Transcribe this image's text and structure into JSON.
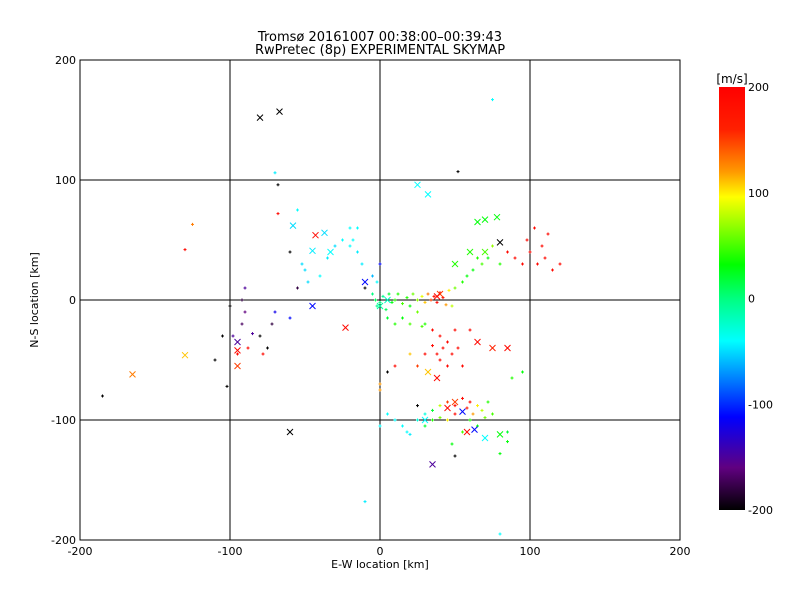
{
  "chart_data": {
    "type": "scatter",
    "title": "Tromsø 20161007 00:38:00–00:39:43",
    "subtitle": "RwPretec (8p) EXPERIMENTAL SKYMAP",
    "xlabel": "E-W location [km]",
    "ylabel": "N-S location [km]",
    "xlim": [
      -200,
      200
    ],
    "ylim": [
      -200,
      200
    ],
    "xticks": [
      "-200",
      "-100",
      "0",
      "100",
      "200"
    ],
    "yticks": [
      "-200",
      "-100",
      "0",
      "100",
      "200"
    ],
    "grid": true,
    "colorbar": {
      "label": "[m/s]",
      "range": [
        -200,
        200
      ],
      "ticks": [
        "200",
        "100",
        "0",
        "-100",
        "-200"
      ]
    },
    "crosses": [
      [
        -80,
        152,
        -200
      ],
      [
        -67,
        157,
        -200
      ],
      [
        -43,
        54,
        190
      ],
      [
        -37,
        56,
        -50
      ],
      [
        -58,
        62,
        -50
      ],
      [
        -45,
        41,
        -45
      ],
      [
        -33,
        40,
        -40
      ],
      [
        -45,
        -5,
        -110
      ],
      [
        -23,
        -23,
        190
      ],
      [
        -10,
        15,
        -110
      ],
      [
        -130,
        -46,
        110
      ],
      [
        -165,
        -62,
        130
      ],
      [
        -95,
        -55,
        150
      ],
      [
        -95,
        -35,
        -150
      ],
      [
        -60,
        -110,
        -200
      ],
      [
        25,
        96,
        -40
      ],
      [
        32,
        88,
        -40
      ],
      [
        65,
        65,
        30
      ],
      [
        70,
        67,
        30
      ],
      [
        78,
        69,
        30
      ],
      [
        80,
        48,
        -200
      ],
      [
        60,
        40,
        40
      ],
      [
        50,
        30,
        40
      ],
      [
        40,
        5,
        150
      ],
      [
        38,
        3,
        190
      ],
      [
        35,
        -137,
        -150
      ],
      [
        58,
        -110,
        190
      ],
      [
        80,
        -112,
        30
      ],
      [
        70,
        -115,
        -40
      ],
      [
        63,
        -108,
        -110
      ],
      [
        50,
        -85,
        150
      ],
      [
        45,
        -90,
        190
      ],
      [
        38,
        -65,
        190
      ],
      [
        32,
        -60,
        110
      ],
      [
        65,
        -35,
        190
      ],
      [
        75,
        -40,
        160
      ],
      [
        55,
        -93,
        -110
      ],
      [
        30,
        -100,
        -40
      ],
      [
        5,
        0,
        -20
      ],
      [
        0,
        -5,
        -10
      ],
      [
        -95,
        -42,
        190
      ],
      [
        70,
        40,
        50
      ],
      [
        85,
        -40,
        190
      ]
    ],
    "points": [
      [
        -185,
        -80,
        -200
      ],
      [
        -125,
        63,
        130
      ],
      [
        -130,
        42,
        190
      ],
      [
        -100,
        -5,
        -200
      ],
      [
        -105,
        -30,
        -200
      ],
      [
        -110,
        -50,
        -200
      ],
      [
        -102,
        -72,
        -200
      ],
      [
        -98,
        -30,
        -150
      ],
      [
        -92,
        -20,
        -170
      ],
      [
        -90,
        -10,
        -160
      ],
      [
        -95,
        -45,
        190
      ],
      [
        -88,
        -40,
        190
      ],
      [
        -85,
        -28,
        -150
      ],
      [
        -80,
        -30,
        -200
      ],
      [
        -75,
        -40,
        -200
      ],
      [
        -72,
        -20,
        -180
      ],
      [
        -70,
        -10,
        -120
      ],
      [
        -90,
        10,
        -150
      ],
      [
        -92,
        0,
        -180
      ],
      [
        -78,
        -45,
        190
      ],
      [
        -70,
        106,
        -45
      ],
      [
        -68,
        96,
        -200
      ],
      [
        -68,
        72,
        190
      ],
      [
        -55,
        75,
        -40
      ],
      [
        -60,
        40,
        -200
      ],
      [
        -50,
        25,
        -50
      ],
      [
        -48,
        15,
        -50
      ],
      [
        -52,
        30,
        -50
      ],
      [
        -55,
        10,
        -180
      ],
      [
        -60,
        -15,
        -110
      ],
      [
        -40,
        20,
        -40
      ],
      [
        -35,
        35,
        -45
      ],
      [
        -25,
        50,
        -40
      ],
      [
        -20,
        60,
        -40
      ],
      [
        -18,
        50,
        -40
      ],
      [
        -15,
        40,
        -45
      ],
      [
        -12,
        30,
        -45
      ],
      [
        -15,
        60,
        -40
      ],
      [
        -20,
        45,
        -40
      ],
      [
        -30,
        45,
        -50
      ],
      [
        -10,
        10,
        -200
      ],
      [
        -5,
        20,
        -60
      ],
      [
        0,
        30,
        -110
      ],
      [
        -2,
        15,
        -40
      ],
      [
        -5,
        5,
        0
      ],
      [
        -3,
        0,
        10
      ],
      [
        0,
        -2,
        0
      ],
      [
        2,
        3,
        -5
      ],
      [
        -2,
        -5,
        -5
      ],
      [
        4,
        -8,
        10
      ],
      [
        6,
        5,
        20
      ],
      [
        8,
        -2,
        30
      ],
      [
        10,
        0,
        40
      ],
      [
        12,
        5,
        40
      ],
      [
        15,
        -3,
        50
      ],
      [
        18,
        2,
        40
      ],
      [
        20,
        -5,
        30
      ],
      [
        22,
        5,
        60
      ],
      [
        25,
        0,
        70
      ],
      [
        28,
        3,
        90
      ],
      [
        30,
        -2,
        110
      ],
      [
        32,
        5,
        130
      ],
      [
        34,
        0,
        150
      ],
      [
        36,
        3,
        180
      ],
      [
        38,
        -2,
        190
      ],
      [
        40,
        6,
        190
      ],
      [
        42,
        2,
        180
      ],
      [
        44,
        -4,
        120
      ],
      [
        46,
        8,
        100
      ],
      [
        48,
        -5,
        80
      ],
      [
        50,
        10,
        60
      ],
      [
        55,
        15,
        40
      ],
      [
        58,
        20,
        30
      ],
      [
        62,
        25,
        30
      ],
      [
        65,
        35,
        40
      ],
      [
        68,
        30,
        50
      ],
      [
        72,
        35,
        30
      ],
      [
        75,
        45,
        70
      ],
      [
        80,
        30,
        40
      ],
      [
        85,
        40,
        190
      ],
      [
        90,
        35,
        190
      ],
      [
        95,
        30,
        190
      ],
      [
        100,
        40,
        190
      ],
      [
        105,
        30,
        190
      ],
      [
        110,
        35,
        190
      ],
      [
        115,
        25,
        190
      ],
      [
        120,
        30,
        190
      ],
      [
        98,
        50,
        190
      ],
      [
        103,
        60,
        190
      ],
      [
        108,
        45,
        190
      ],
      [
        112,
        55,
        190
      ],
      [
        95,
        -60,
        30
      ],
      [
        88,
        -65,
        40
      ],
      [
        30,
        -20,
        40
      ],
      [
        35,
        -25,
        190
      ],
      [
        40,
        -30,
        190
      ],
      [
        45,
        -35,
        190
      ],
      [
        42,
        -40,
        190
      ],
      [
        38,
        -45,
        190
      ],
      [
        48,
        -45,
        190
      ],
      [
        52,
        -40,
        190
      ],
      [
        40,
        -50,
        190
      ],
      [
        45,
        -55,
        190
      ],
      [
        35,
        -38,
        190
      ],
      [
        50,
        -25,
        190
      ],
      [
        30,
        -45,
        190
      ],
      [
        25,
        -55,
        150
      ],
      [
        20,
        -45,
        110
      ],
      [
        60,
        -25,
        190
      ],
      [
        55,
        -55,
        190
      ],
      [
        10,
        -55,
        190
      ],
      [
        5,
        -60,
        -200
      ],
      [
        0,
        -70,
        120
      ],
      [
        20,
        -20,
        50
      ],
      [
        10,
        -20,
        40
      ],
      [
        15,
        -15,
        30
      ],
      [
        5,
        -15,
        20
      ],
      [
        25,
        -10,
        60
      ],
      [
        28,
        -22,
        50
      ],
      [
        5,
        -95,
        -40
      ],
      [
        10,
        -100,
        -40
      ],
      [
        15,
        -105,
        -40
      ],
      [
        18,
        -110,
        -40
      ],
      [
        20,
        -112,
        -45
      ],
      [
        25,
        -100,
        -30
      ],
      [
        30,
        -95,
        -30
      ],
      [
        35,
        -92,
        20
      ],
      [
        40,
        -88,
        80
      ],
      [
        45,
        -85,
        150
      ],
      [
        50,
        -88,
        190
      ],
      [
        55,
        -82,
        190
      ],
      [
        58,
        -90,
        170
      ],
      [
        60,
        -85,
        190
      ],
      [
        62,
        -95,
        120
      ],
      [
        65,
        -88,
        100
      ],
      [
        68,
        -92,
        80
      ],
      [
        70,
        -98,
        60
      ],
      [
        72,
        -85,
        40
      ],
      [
        40,
        -98,
        60
      ],
      [
        45,
        -100,
        100
      ],
      [
        50,
        -95,
        190
      ],
      [
        35,
        -100,
        40
      ],
      [
        30,
        -105,
        20
      ],
      [
        60,
        -100,
        40
      ],
      [
        65,
        -105,
        30
      ],
      [
        75,
        -95,
        50
      ],
      [
        55,
        -110,
        50
      ],
      [
        48,
        -120,
        30
      ],
      [
        50,
        -130,
        -200
      ],
      [
        80,
        -128,
        30
      ],
      [
        85,
        -118,
        30
      ],
      [
        0,
        -105,
        -40
      ],
      [
        -10,
        -168,
        -45
      ],
      [
        80,
        -195,
        -40
      ],
      [
        52,
        107,
        -200
      ],
      [
        75,
        167,
        -40
      ],
      [
        25,
        -88,
        -200
      ],
      [
        85,
        -110,
        20
      ],
      [
        0,
        -75,
        120
      ]
    ]
  }
}
